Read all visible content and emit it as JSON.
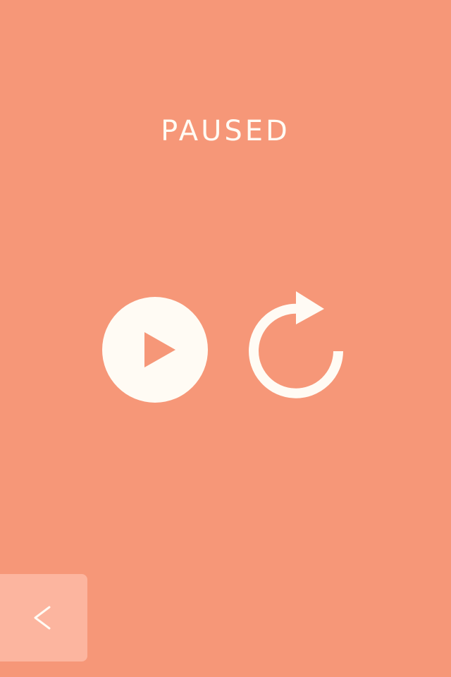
{
  "pause_screen": {
    "title": "PAUSED",
    "play_icon": "play-icon",
    "restart_icon": "restart-icon",
    "back_icon": "chevron-left-icon"
  },
  "colors": {
    "background": "#F69778",
    "foreground": "#FFFBF4",
    "back_button": "#FCB59F"
  }
}
